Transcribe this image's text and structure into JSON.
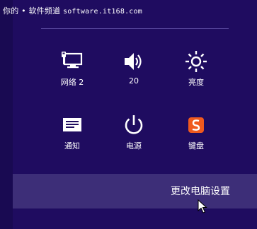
{
  "watermark": {
    "prefix": "你的 • 软件频道",
    "url": "software.it168.com"
  },
  "quick_settings": [
    {
      "id": "network",
      "label": "网络 2",
      "icon": "network-icon"
    },
    {
      "id": "volume",
      "label": "20",
      "icon": "volume-icon"
    },
    {
      "id": "brightness",
      "label": "亮度",
      "icon": "brightness-icon"
    },
    {
      "id": "notifications",
      "label": "通知",
      "icon": "notifications-icon"
    },
    {
      "id": "power",
      "label": "电源",
      "icon": "power-icon"
    },
    {
      "id": "keyboard",
      "label": "键盘",
      "icon": "keyboard-icon"
    }
  ],
  "footer": {
    "change_pc_settings": "更改电脑设置"
  },
  "colors": {
    "background": "#1f0c60",
    "bar": "#3d2e78",
    "sogou_orange": "#f05a1e"
  }
}
